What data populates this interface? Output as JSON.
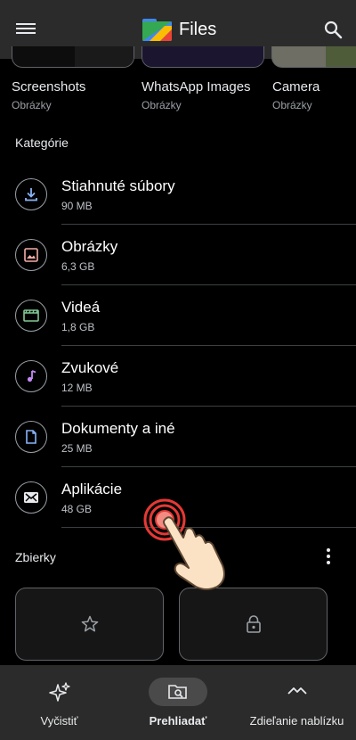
{
  "app": {
    "title": "Files"
  },
  "folders": [
    {
      "name": "Screenshots",
      "subtitle": "Obrázky"
    },
    {
      "name": "WhatsApp Images",
      "subtitle": "Obrázky"
    },
    {
      "name": "Camera",
      "subtitle": "Obrázky"
    }
  ],
  "categories_label": "Kategórie",
  "categories": [
    {
      "name": "Stiahnuté súbory",
      "size": "90 MB",
      "icon": "download-icon",
      "color": "#8ab4f8"
    },
    {
      "name": "Obrázky",
      "size": "6,3 GB",
      "icon": "image-icon",
      "color": "#f6aea9"
    },
    {
      "name": "Videá",
      "size": "1,8 GB",
      "icon": "video-icon",
      "color": "#81c995"
    },
    {
      "name": "Zvukové",
      "size": "12 MB",
      "icon": "music-note-icon",
      "color": "#c58af9"
    },
    {
      "name": "Dokumenty a iné",
      "size": "25 MB",
      "icon": "document-icon",
      "color": "#8ab4f8"
    },
    {
      "name": "Aplikácie",
      "size": "48 GB",
      "icon": "android-icon",
      "color": "#e8eaed"
    }
  ],
  "collections_label": "Zbierky",
  "collections": [
    {
      "icon": "star-icon"
    },
    {
      "icon": "lock-icon"
    }
  ],
  "bottom_nav": [
    {
      "label": "Vyčistiť",
      "icon": "sparkle-icon",
      "active": false
    },
    {
      "label": "Prehliadať",
      "icon": "browse-icon",
      "active": true
    },
    {
      "label": "Zdieľanie nablízku",
      "icon": "nearby-share-icon",
      "active": false
    }
  ]
}
